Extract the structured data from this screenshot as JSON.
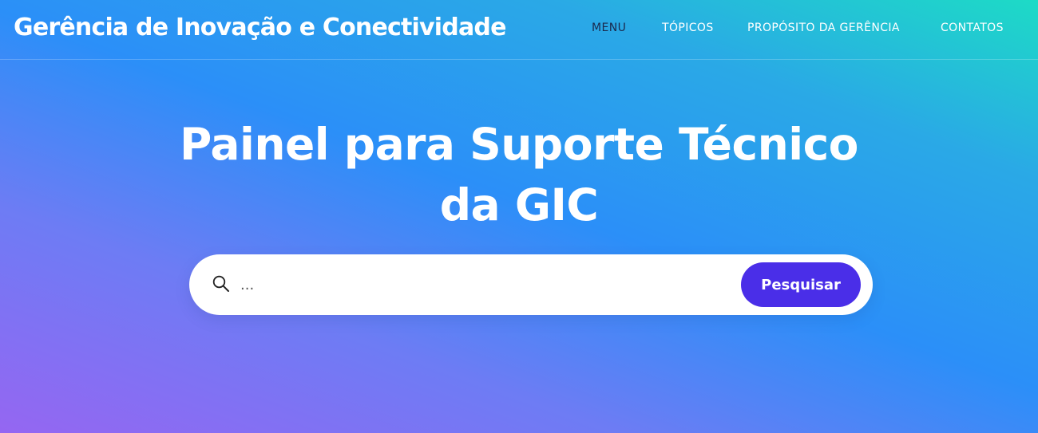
{
  "header": {
    "brand": "Gerência de Inovação e Conectividade",
    "nav": [
      {
        "label": "MENU",
        "active": true
      },
      {
        "label": "TÓPICOS",
        "active": false
      },
      {
        "label": "PROPÓSITO DA GERÊNCIA",
        "active": false
      },
      {
        "label": "CONTATOS",
        "active": false
      }
    ]
  },
  "hero": {
    "title_line1": "Painel para Suporte Técnico",
    "title_line2": "da GIC"
  },
  "search": {
    "icon": "search-icon",
    "placeholder": "...",
    "value": "",
    "button_label": "Pesquisar"
  },
  "colors": {
    "gradient_top_right": "#1ddbc6",
    "gradient_mid": "#2b8ff8",
    "gradient_bottom_left": "#9566f2",
    "search_button": "#4a2ee8",
    "active_nav": "#1b2a4e",
    "text": "#ffffff"
  }
}
